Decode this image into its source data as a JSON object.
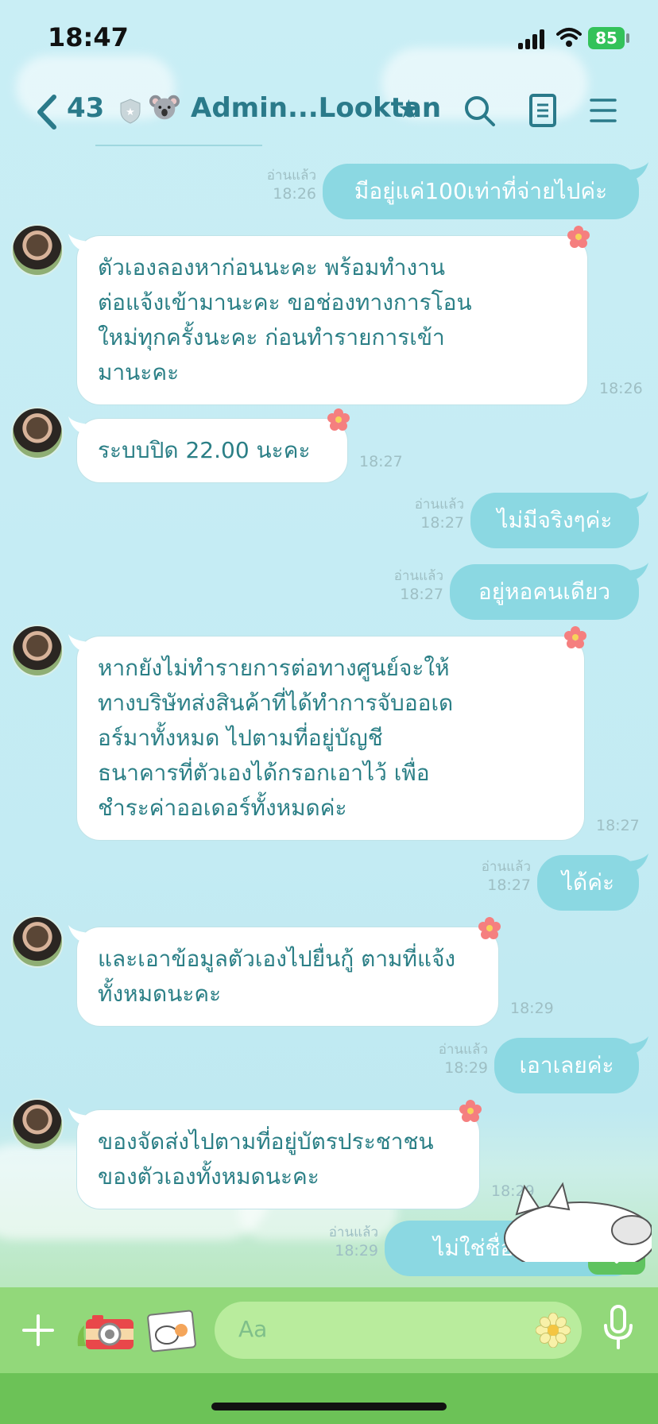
{
  "status_bar": {
    "time": "18:47",
    "battery": "85"
  },
  "header": {
    "unread_count": "43",
    "title": "Admin...Looktan",
    "icons": [
      "back-chevron-icon",
      "shield-icon",
      "koala-icon",
      "star-icon",
      "search-icon",
      "notes-icon",
      "menu-icon"
    ]
  },
  "messages": [
    {
      "side": "out",
      "text": "มีอยู่แค่100เท่าที่จ่ายไปค่ะ",
      "read": "อ่านแล้ว",
      "time": "18:26"
    },
    {
      "side": "in",
      "lines": [
        "ตัวเองลองหาก่อนนะคะ พร้อมทำงาน",
        "ต่อแจ้งเข้ามานะคะ ขอช่องทางการโอน",
        "ใหม่ทุกครั้งนะคะ ก่อนทำรายการเข้า",
        "มานะคะ"
      ],
      "time": "18:26"
    },
    {
      "side": "in",
      "lines": [
        "ระบบปิด 22.00 นะคะ"
      ],
      "time": "18:27"
    },
    {
      "side": "out",
      "text": "ไม่มีจริงๆค่ะ",
      "read": "อ่านแล้ว",
      "time": "18:27"
    },
    {
      "side": "out",
      "text": "อยู่หอคนเดียว",
      "read": "อ่านแล้ว",
      "time": "18:27"
    },
    {
      "side": "in",
      "lines": [
        "หากยังไม่ทำรายการต่อทางศูนย์จะให้",
        "ทางบริษัทส่งสินค้าที่ได้ทำการจับออเด",
        "อร์มาทั้งหมด ไปตามที่อยู่บัญชี",
        "ธนาคารที่ตัวเองได้กรอกเอาไว้ เพื่อ",
        "ชำระค่าออเดอร์ทั้งหมดค่ะ"
      ],
      "time": "18:27"
    },
    {
      "side": "out",
      "text": "ได้ค่ะ",
      "read": "อ่านแล้ว",
      "time": "18:27"
    },
    {
      "side": "in",
      "lines": [
        "และเอาข้อมูลตัวเองไปยื่นกู้ ตามที่แจ้ง",
        "ทั้งหมดนะคะ"
      ],
      "time": "18:29"
    },
    {
      "side": "out",
      "text": "เอาเลยค่ะ",
      "read": "อ่านแล้ว",
      "time": "18:29"
    },
    {
      "side": "in",
      "lines": [
        "ของจัดส่งไปตามที่อยู่บัตรประชาชน",
        "ของตัวเองทั้งหมดนะคะ"
      ],
      "time": "18:29"
    },
    {
      "side": "out",
      "text": "ไม่ใช่ชื่อจริงอยู่แ",
      "read": "อ่านแล้ว",
      "time": "18:29"
    }
  ],
  "composer": {
    "placeholder": "Aa"
  },
  "colors": {
    "accent": "#2a7a8a",
    "out_bubble": "#8bd8e2",
    "in_text": "#2b7f86",
    "footer": "#92d87a"
  }
}
